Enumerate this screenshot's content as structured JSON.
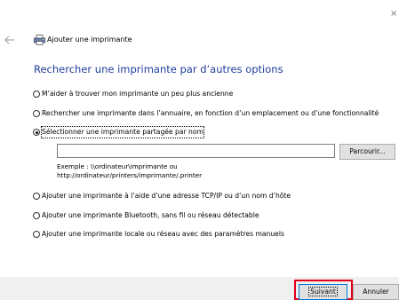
{
  "header": {
    "title": "Ajouter une imprimante",
    "close_glyph": "×"
  },
  "main": {
    "heading": "Rechercher une imprimante par d’autres options",
    "options": [
      {
        "label": "M’aider à trouver mon imprimante un peu plus ancienne",
        "checked": false
      },
      {
        "label": "Rechercher une imprimante dans l’annuaire, en fonction d’un emplacement ou d’une fonctionnalité",
        "checked": false
      },
      {
        "label": "Sélectionner une imprimante partagée par nom",
        "checked": true
      },
      {
        "label": "Ajouter une imprimante à l’aide d’une adresse TCP/IP ou d’un nom d’hôte",
        "checked": false
      },
      {
        "label": "Ajouter une imprimante Bluetooth, sans fil ou réseau détectable",
        "checked": false
      },
      {
        "label": "Ajouter une imprimante locale ou réseau avec des paramètres manuels",
        "checked": false
      }
    ],
    "share_name_input": {
      "value": ""
    },
    "browse_label": "Parcourir...",
    "example_line1": "Exemple : \\\\ordinateur\\imprimante ou",
    "example_line2": "http://ordinateur/printers/imprimante/.printer"
  },
  "footer": {
    "next_label": "Suivant",
    "cancel_label": "Annuler"
  },
  "colors": {
    "heading": "#1f3d9a",
    "highlight": "#e0001b",
    "default_button_border": "#0078d7",
    "footer_bg": "#f0f0f0"
  },
  "icons": {
    "back": "back-arrow-icon",
    "printer": "printer-icon",
    "close": "close-icon"
  }
}
